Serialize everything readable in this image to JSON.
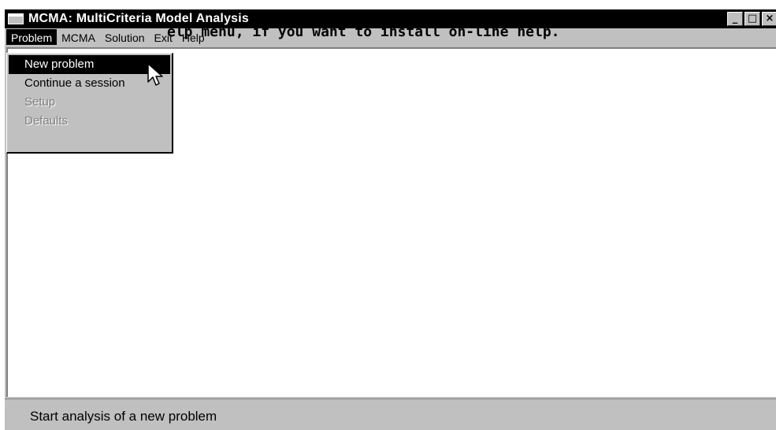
{
  "window": {
    "title": "MCMA: MultiCriteria Model Analysis",
    "controls": {
      "minimize": "_",
      "maximize": "□",
      "close": "×"
    }
  },
  "menubar": {
    "items": [
      {
        "label": "Problem",
        "active": true
      },
      {
        "label": "MCMA",
        "active": false
      },
      {
        "label": "Solution",
        "active": false
      },
      {
        "label": "Exit",
        "active": false
      },
      {
        "label": "Help",
        "active": false
      }
    ]
  },
  "dropdown": {
    "items": [
      {
        "label": "New problem",
        "state": "selected"
      },
      {
        "label": "Continue a session",
        "state": "enabled"
      },
      {
        "label": "Setup",
        "state": "disabled"
      },
      {
        "label": "Defaults",
        "state": "disabled"
      }
    ]
  },
  "client": {
    "message": "elp menu, if you want to install on-line help."
  },
  "statusbar": {
    "text": "Start analysis of a new problem"
  },
  "icons": {
    "window_icon": "window-icon",
    "cursor": "arrow-cursor-icon"
  },
  "colors": {
    "titlebar": "#000000",
    "face": "#c0c0c0",
    "highlight": "#000000",
    "disabled_text": "#808080"
  }
}
